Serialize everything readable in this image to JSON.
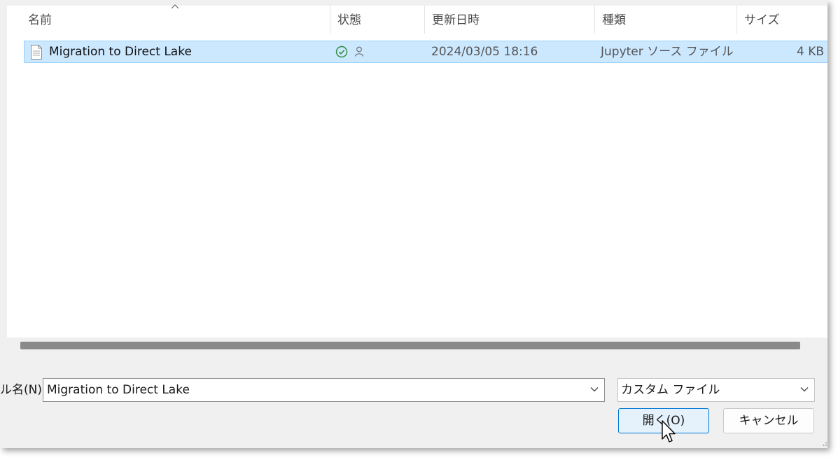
{
  "columns": {
    "name": "名前",
    "status": "状態",
    "modified": "更新日時",
    "type": "種類",
    "size": "サイズ"
  },
  "files": [
    {
      "name": "Migration to Direct Lake",
      "modified": "2024/03/05 18:16",
      "type": "Jupyter ソース ファイル",
      "size": "4 KB",
      "icon": "document-icon",
      "status_icons": [
        "synced-check-icon",
        "shared-person-icon"
      ]
    }
  ],
  "filename": {
    "label": "ル名(N):",
    "value": "Migration to Direct Lake"
  },
  "file_type_filter": {
    "selected": "カスタム ファイル"
  },
  "buttons": {
    "open": "開く(O)",
    "cancel": "キャンセル"
  },
  "colors": {
    "selection": "#cce8ff",
    "selection_border": "#99d1ff",
    "accent": "#0078d4",
    "status_green": "#2e8b3a"
  }
}
